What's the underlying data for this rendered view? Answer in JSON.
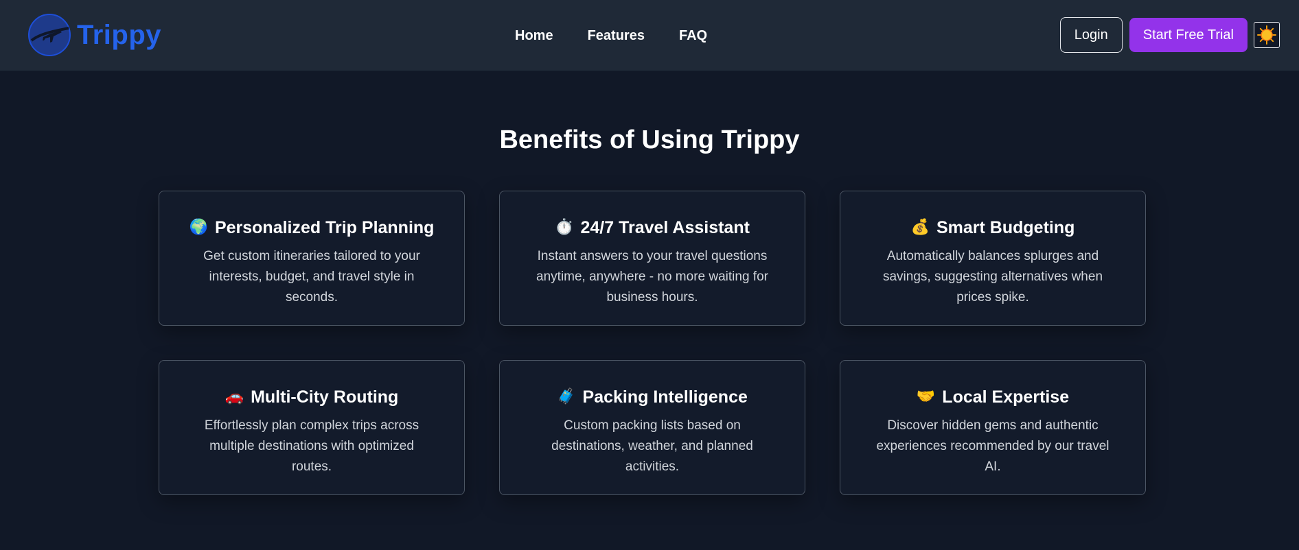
{
  "brand": {
    "name": "Trippy",
    "color": "#2563eb"
  },
  "nav": {
    "links": [
      "Home",
      "Features",
      "FAQ"
    ]
  },
  "actions": {
    "login_label": "Login",
    "trial_label": "Start Free Trial",
    "trial_color": "#9333ea"
  },
  "section": {
    "title": "Benefits of Using Trippy"
  },
  "cards": [
    {
      "emoji": "🌍",
      "title": "Personalized Trip Planning",
      "desc": "Get custom itineraries tailored to your interests, budget, and travel style in seconds."
    },
    {
      "emoji": "⏱️",
      "title": "24/7 Travel Assistant",
      "desc": "Instant answers to your travel questions anytime, anywhere - no more waiting for business hours."
    },
    {
      "emoji": "💰",
      "title": "Smart Budgeting",
      "desc": "Automatically balances splurges and savings, suggesting alternatives when prices spike."
    },
    {
      "emoji": "🚗",
      "title": "Multi-City Routing",
      "desc": "Effortlessly plan complex trips across multiple destinations with optimized routes."
    },
    {
      "emoji": "🧳",
      "title": "Packing Intelligence",
      "desc": "Custom packing lists based on destinations, weather, and planned activities."
    },
    {
      "emoji": "🤝",
      "title": "Local Expertise",
      "desc": "Discover hidden gems and authentic experiences recommended by our travel AI."
    }
  ]
}
